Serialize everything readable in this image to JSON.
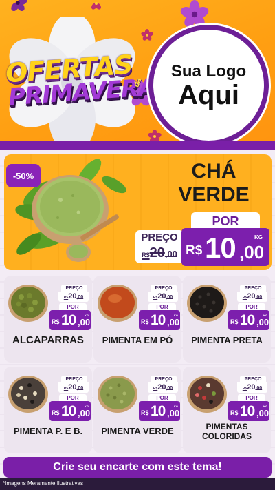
{
  "header": {
    "brand_line1": "OFERTAS",
    "brand_line2": "PRIMAVERA",
    "brand_da": "da",
    "logo_line1": "Sua Logo",
    "logo_line2": "Aqui"
  },
  "colors": {
    "purple": "#7c1fad",
    "orange": "#ffb01f",
    "card_bg": "#ede5ef"
  },
  "featured": {
    "discount": "-50%",
    "title_line1": "CHÁ",
    "title_line2": "VERDE",
    "preco_label": "PREÇO",
    "old_currency": "R$",
    "old_whole": "20",
    "old_cents": ",00",
    "por_label": "POR",
    "new_currency": "R$",
    "new_whole": "10",
    "new_cents": ",00",
    "unit": "KG",
    "image_icon": "green-tea-powder-bowl"
  },
  "products": [
    {
      "name": "ALCAPARRAS",
      "preco_label": "PREÇO",
      "old_currency": "R$",
      "old_whole": "20",
      "old_cents": ",00",
      "por_label": "POR",
      "new_currency": "R$",
      "new_whole": "10",
      "new_cents": ",00",
      "unit": "KG"
    },
    {
      "name": "PIMENTA EM PÓ",
      "preco_label": "PREÇO",
      "old_currency": "R$",
      "old_whole": "20",
      "old_cents": ",00",
      "por_label": "POR",
      "new_currency": "R$",
      "new_whole": "10",
      "new_cents": ",00",
      "unit": "KG"
    },
    {
      "name": "PIMENTA PRETA",
      "preco_label": "PREÇO",
      "old_currency": "R$",
      "old_whole": "20",
      "old_cents": ",00",
      "por_label": "POR",
      "new_currency": "R$",
      "new_whole": "10",
      "new_cents": ",00",
      "unit": "KG"
    },
    {
      "name": "PIMENTA P. E B.",
      "preco_label": "PREÇO",
      "old_currency": "R$",
      "old_whole": "20",
      "old_cents": ",00",
      "por_label": "POR",
      "new_currency": "R$",
      "new_whole": "10",
      "new_cents": ",00",
      "unit": "KG"
    },
    {
      "name": "PIMENTA VERDE",
      "preco_label": "PREÇO",
      "old_currency": "R$",
      "old_whole": "20",
      "old_cents": ",00",
      "por_label": "POR",
      "new_currency": "R$",
      "new_whole": "10",
      "new_cents": ",00",
      "unit": "KG"
    },
    {
      "name": "PIMENTAS COLORIDAS",
      "preco_label": "PREÇO",
      "old_currency": "R$",
      "old_whole": "20",
      "old_cents": ",00",
      "por_label": "POR",
      "new_currency": "R$",
      "new_whole": "10",
      "new_cents": ",00",
      "unit": "KG"
    }
  ],
  "footer": {
    "cta": "Crie seu encarte com este tema!",
    "disclaimer": "*Imagens Meramente Ilustrativas"
  }
}
